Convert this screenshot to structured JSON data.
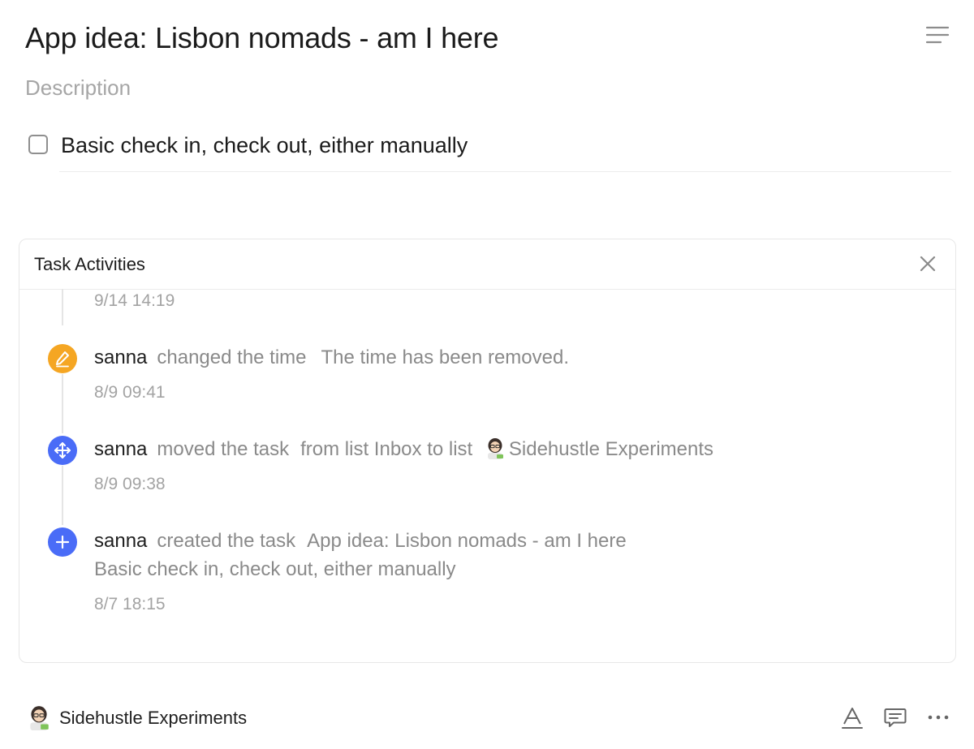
{
  "task": {
    "title": "App idea: Lisbon nomads - am I here",
    "description_placeholder": "Description",
    "checklist": [
      {
        "text": "Basic check in, check out, either manually",
        "checked": false
      }
    ]
  },
  "activities": {
    "title": "Task Activities",
    "top_timestamp": "9/14 14:19",
    "items": [
      {
        "icon": "pencil-icon",
        "icon_color": "#F5A623",
        "user": "sanna",
        "action": "changed the time",
        "detail": "The time has been removed.",
        "timestamp": "8/9 09:41"
      },
      {
        "icon": "move-arrows-icon",
        "icon_color": "#4A6CF7",
        "user": "sanna",
        "action": "moved the task",
        "detail": "from list Inbox to list",
        "detail_list_emoji": "woman-technologist-icon",
        "detail_list_name": "Sidehustle Experiments",
        "timestamp": "8/9 09:38"
      },
      {
        "icon": "plus-icon",
        "icon_color": "#4A6CF7",
        "user": "sanna",
        "action": "created the task",
        "detail": "App idea: Lisbon nomads - am I here",
        "detail_line2": "Basic check in, check out, either manually",
        "timestamp": "8/7 18:15"
      }
    ]
  },
  "footer": {
    "list_icon": "woman-technologist-icon",
    "list_name": "Sidehustle Experiments",
    "actions": [
      "text-format-icon",
      "comment-icon",
      "more-icon"
    ]
  }
}
